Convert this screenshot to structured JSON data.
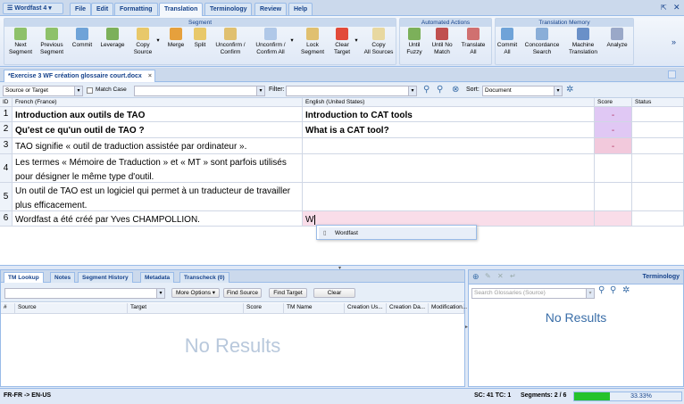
{
  "app": {
    "menu_label": "Wordfast 4"
  },
  "tabs": [
    "File",
    "Edit",
    "Formatting",
    "Translation",
    "Terminology",
    "Review",
    "Help"
  ],
  "ribbon": {
    "groups": {
      "segment": "Segment",
      "automated": "Automated Actions",
      "tm": "Translation Memory"
    },
    "buttons": [
      {
        "l1": "Next",
        "l2": "Segment"
      },
      {
        "l1": "Previous",
        "l2": "Segment"
      },
      {
        "l1": "Commit",
        "l2": ""
      },
      {
        "l1": "Leverage",
        "l2": ""
      },
      {
        "l1": "Copy",
        "l2": "Source"
      },
      {
        "l1": "Merge",
        "l2": ""
      },
      {
        "l1": "Split",
        "l2": ""
      },
      {
        "l1": "Unconfirm /",
        "l2": "Confirm"
      },
      {
        "l1": "Unconfirm /",
        "l2": "Confirm All"
      },
      {
        "l1": "Lock",
        "l2": "Segment"
      },
      {
        "l1": "Clear",
        "l2": "Target"
      },
      {
        "l1": "Copy",
        "l2": "All Sources"
      },
      {
        "l1": "Until",
        "l2": "Fuzzy"
      },
      {
        "l1": "Until No",
        "l2": "Match"
      },
      {
        "l1": "Translate",
        "l2": "All"
      },
      {
        "l1": "Commit",
        "l2": "All"
      },
      {
        "l1": "Concordance",
        "l2": "Search"
      },
      {
        "l1": "Machine",
        "l2": "Translation"
      },
      {
        "l1": "Analyze",
        "l2": ""
      }
    ]
  },
  "doc": {
    "tab_title": "*Exercise 3 WF création glossaire court.docx"
  },
  "filter": {
    "scope": "Source or Target",
    "match_case": "Match Case",
    "filter_label": "Filter:",
    "sort_label": "Sort:",
    "sort_value": "Document"
  },
  "grid": {
    "headers": {
      "id": "ID",
      "source": "French (France)",
      "target": "English (United States)",
      "score": "Score",
      "status": "Status"
    },
    "rows": [
      {
        "id": "1",
        "source": "Introduction aux outils de TAO",
        "target": "Introduction to CAT tools",
        "score": "-"
      },
      {
        "id": "2",
        "source": "Qu'est ce qu'un outil de TAO ?",
        "target": "What is a CAT tool?",
        "score": "-"
      },
      {
        "id": "3",
        "source": "TAO signifie « outil de traduction assistée par ordinateur ».",
        "target": "",
        "score": "-"
      },
      {
        "id": "4",
        "source": "Les termes « Mémoire de Traduction » et « MT » sont parfois utilisés pour désigner le même type d'outil.",
        "target": "",
        "score": ""
      },
      {
        "id": "5",
        "source": "Un outil de TAO est un logiciel qui permet à un traducteur de travailler plus efficacement.",
        "target": "",
        "score": ""
      },
      {
        "id": "6",
        "source": "Wordfast a été créé par Yves CHAMPOLLION.",
        "target": "W",
        "score": ""
      }
    ],
    "autocomplete": "Wordfast"
  },
  "tm_panel": {
    "tabs": [
      "TM Lookup",
      "Notes",
      "Segment History",
      "Metadata",
      "Transcheck (0)"
    ],
    "more_options": "More Options",
    "find_source": "Find Source",
    "find_target": "Find Target",
    "clear": "Clear",
    "columns": [
      "#",
      "Source",
      "Target",
      "Score",
      "TM Name",
      "Creation Us...",
      "Creation Da...",
      "Modification..."
    ],
    "empty": "No Results"
  },
  "term_panel": {
    "title": "Terminology",
    "search_placeholder": "Search Glossaries (Source)",
    "empty": "No Results"
  },
  "status": {
    "langs": "FR-FR -> EN-US",
    "counts": "SC: 41 TC: 1",
    "segments": "Segments: 2 / 6",
    "percent": "33.33%",
    "progress": 0.3333
  },
  "colors": {
    "accent": "#15428b",
    "score_purple": "#e0c8f4",
    "active_row": "#f9dde9",
    "progress": "#25c22b"
  }
}
